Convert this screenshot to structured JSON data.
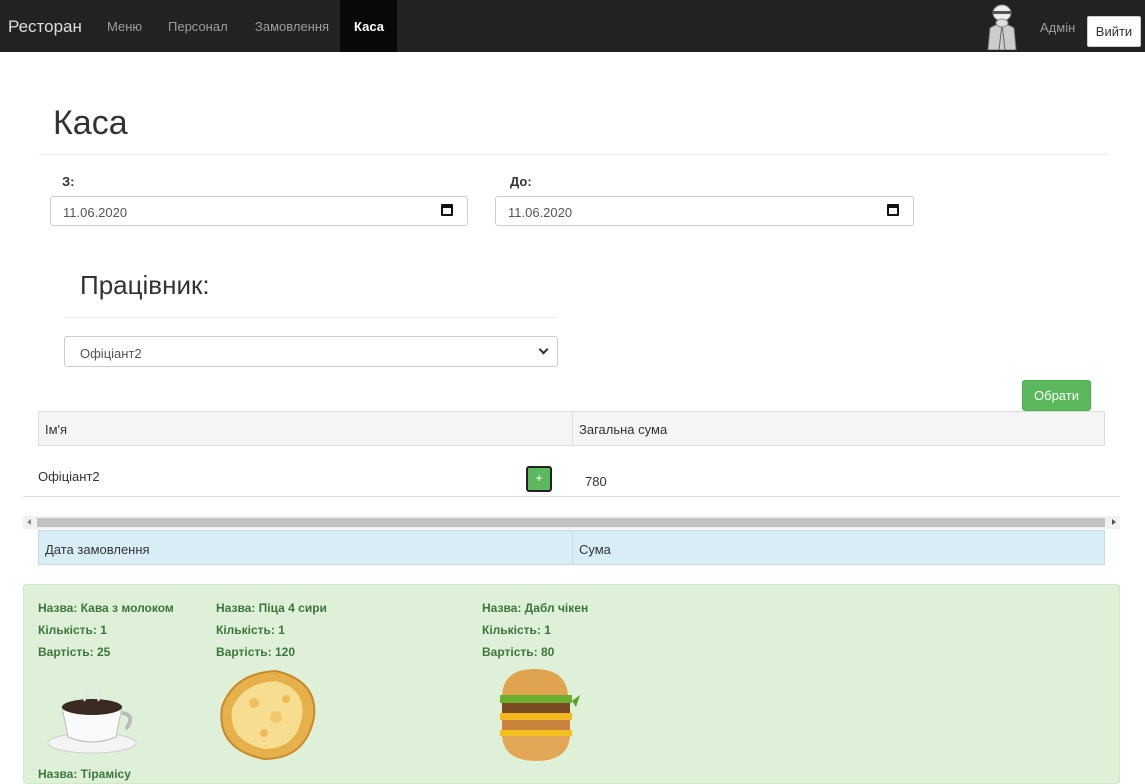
{
  "nav": {
    "brand": "Ресторан",
    "links": [
      "Меню",
      "Персонал",
      "Замовлення"
    ],
    "active": "Каса",
    "user": "Адмін",
    "logout": "Вийти"
  },
  "page": {
    "title": "Каса"
  },
  "filters": {
    "from_label": "З:",
    "from_value": "11.06.2020",
    "to_label": "До:",
    "to_value": "11.06.2020"
  },
  "employee": {
    "title": "Працівник:",
    "selected": "Офіціант2",
    "choose_button": "Обрати"
  },
  "table": {
    "headers": [
      "Ім'я",
      "Загальна сума"
    ],
    "row": {
      "name": "Офіціант2",
      "plus": "+",
      "total": "780"
    }
  },
  "orders": {
    "headers": [
      "Дата замовлення",
      "Сума"
    ]
  },
  "items": [
    {
      "name": "Назва: Кава з молоком",
      "qty": "Кількість: 1",
      "price": "Вартість: 25",
      "image": "coffee-cup"
    },
    {
      "name": "Назва: Піца 4 сири",
      "qty": "Кількість: 1",
      "price": "Вартість: 120",
      "image": "pizza"
    },
    {
      "name": "Назва: Дабл чікен",
      "qty": "Кількість: 1",
      "price": "Вартість: 80",
      "image": "burger"
    },
    {
      "name": "Назва: Тірамісу"
    }
  ],
  "colors": {
    "navbar": "#222222",
    "success": "#5cb85c",
    "info_bg": "#d9edf7",
    "success_bg": "#dff0d8",
    "success_text": "#3c763d"
  }
}
